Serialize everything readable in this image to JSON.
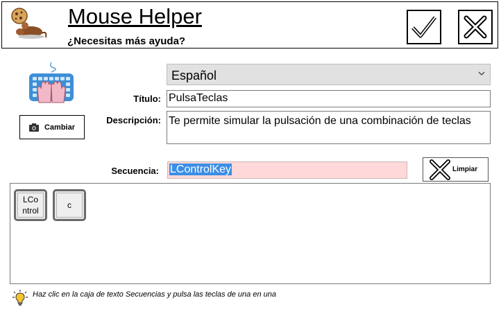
{
  "header": {
    "title": "Mouse Helper",
    "subtitle": "¿Necesitas más ayuda?",
    "icons": {
      "logo": "mouse-icon",
      "ok": "checkmark-icon",
      "close": "close-icon"
    }
  },
  "language": {
    "selected": "Español"
  },
  "form": {
    "title_label": "Título:",
    "title_value": "PulsaTeclas",
    "description_label": "Descripción:",
    "description_value": "Te permite simular la pulsación de una combinación de teclas",
    "change_button": "Cambiar",
    "sequence_label": "Secuencia:",
    "sequence_value": "LControlKey",
    "clear_button": "Limpiar"
  },
  "keys": [
    {
      "label_line1": "LCo",
      "label_line2": "ntrol"
    },
    {
      "label_line1": "c",
      "label_line2": ""
    }
  ],
  "hint": {
    "text": "Haz clic en la caja de texto Secuencias y pulsa las teclas de una en una"
  },
  "colors": {
    "sequence_bg": "#ffd9d9",
    "selection": "#3b8ee6",
    "select_bg": "#e1e1e1"
  }
}
